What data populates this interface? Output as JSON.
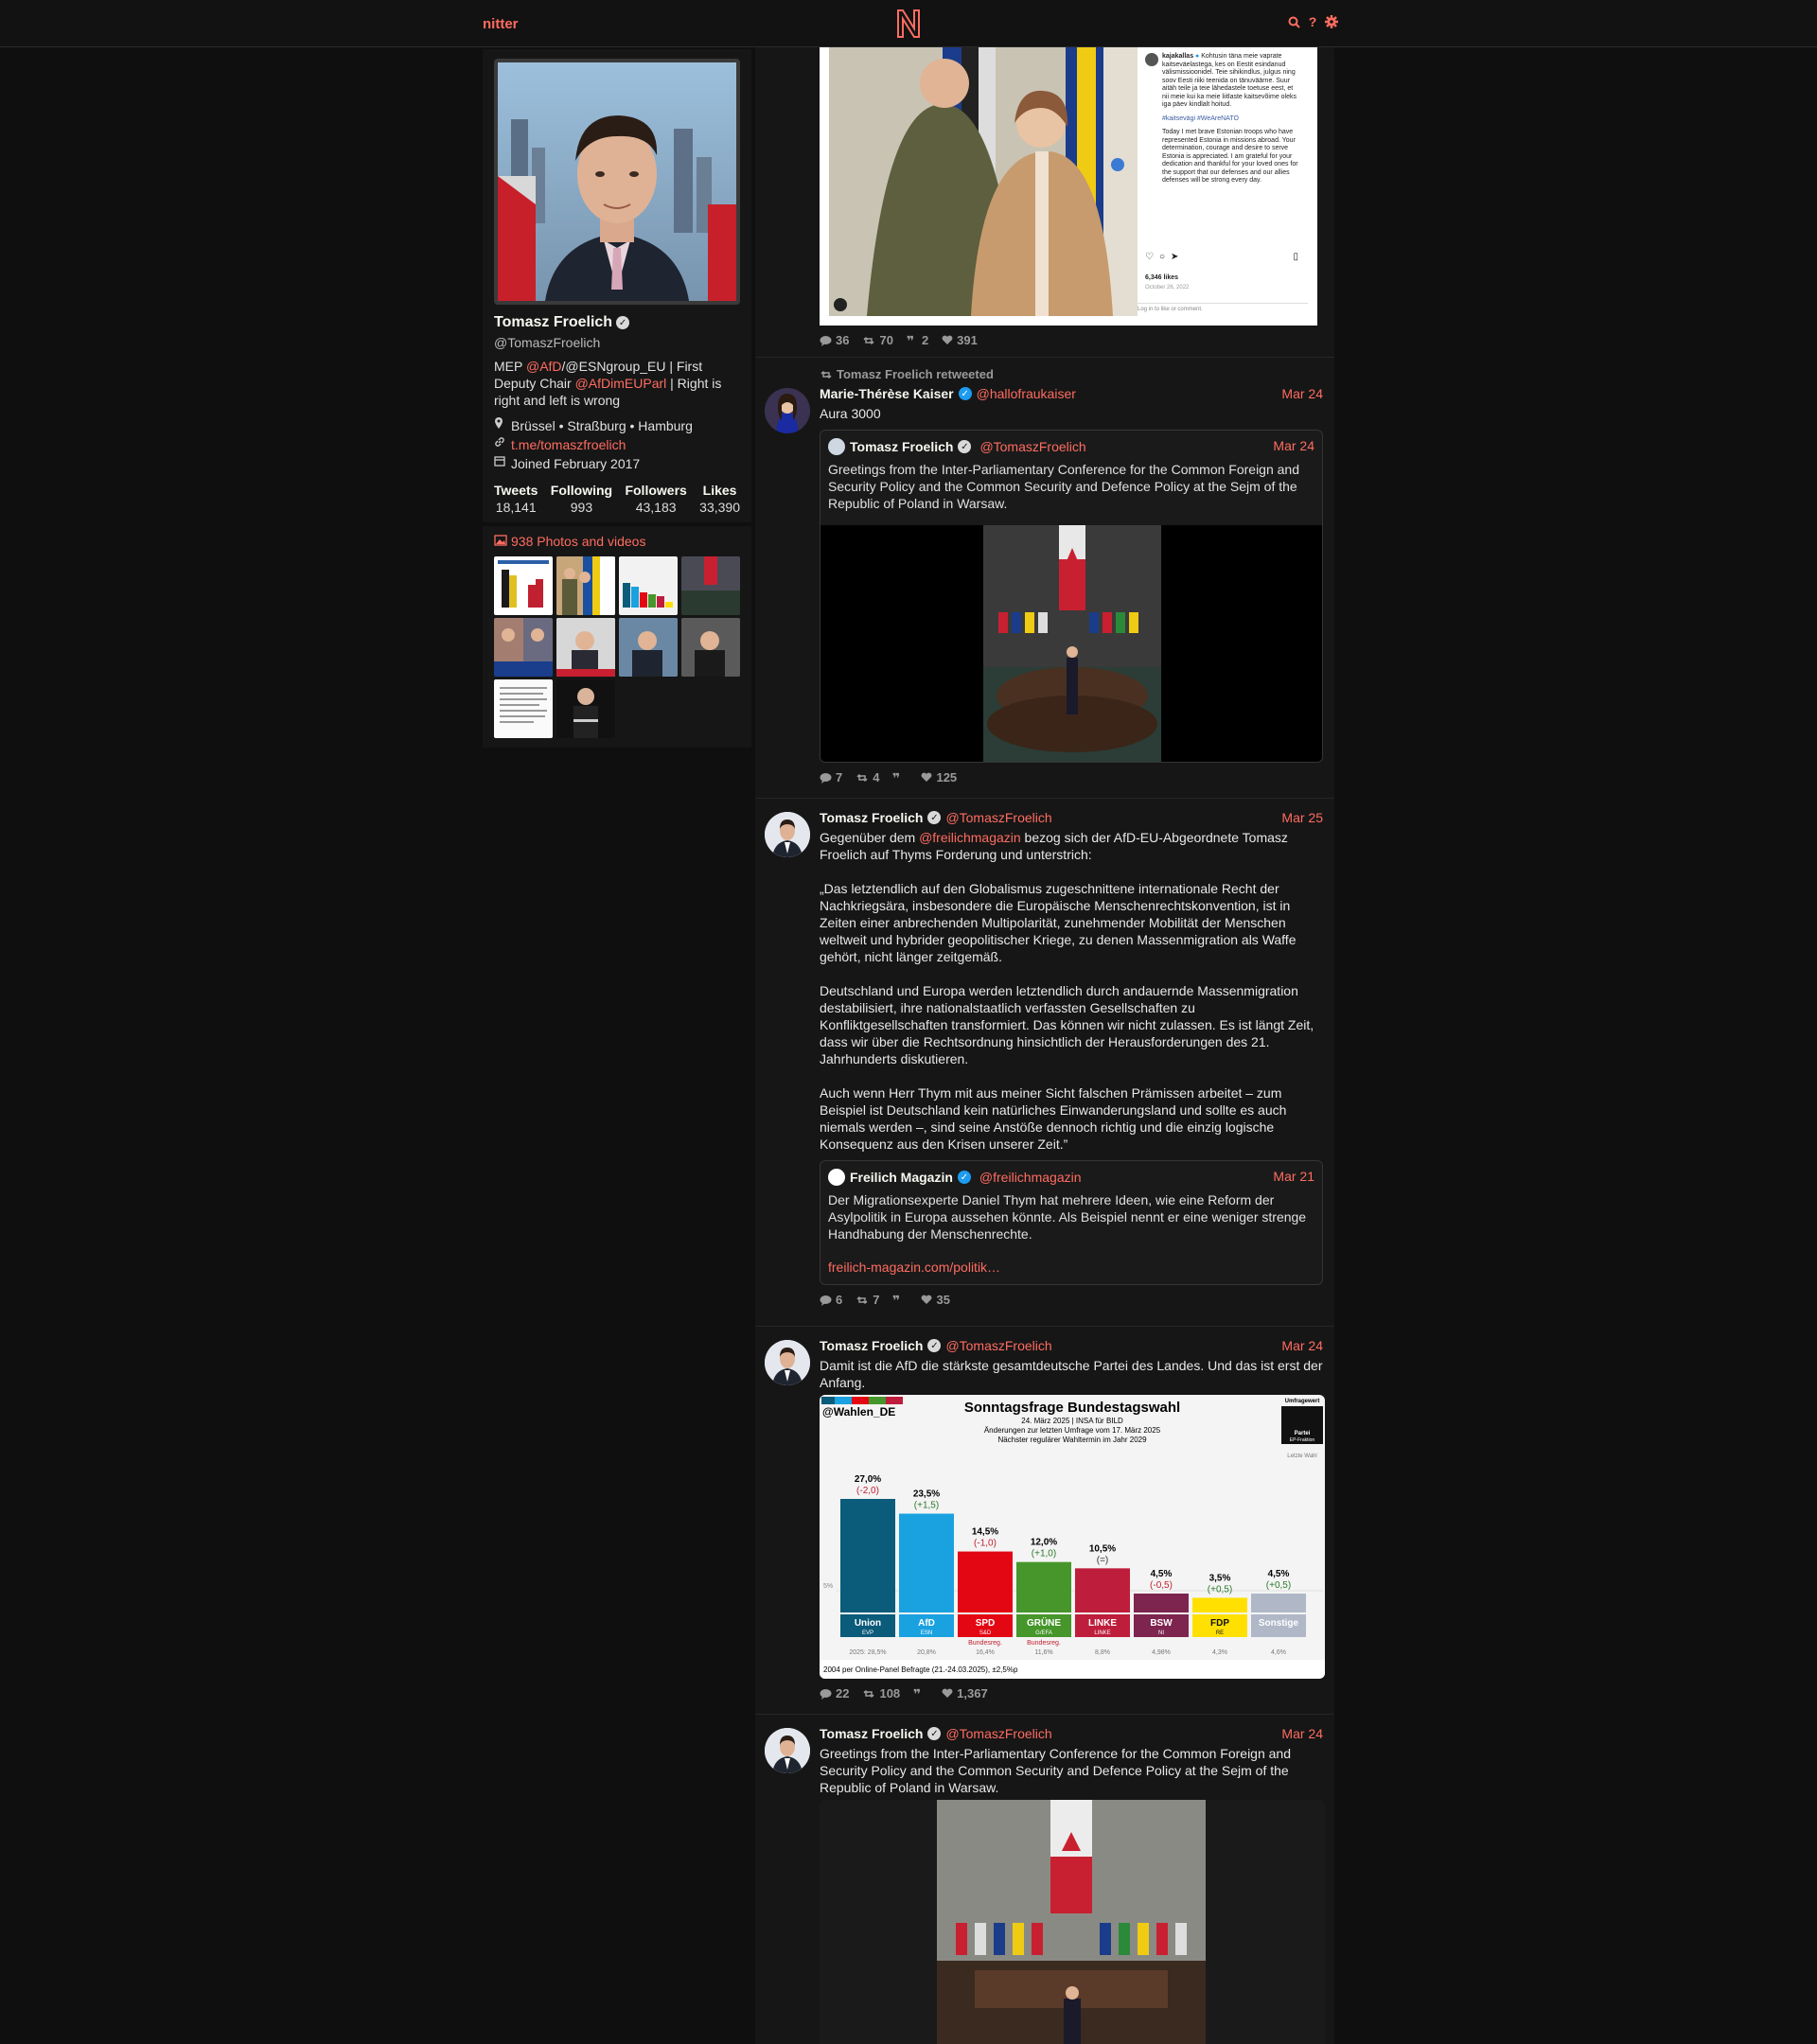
{
  "nav": {
    "brand": "nitter"
  },
  "profile": {
    "name": "Tomasz Froelich",
    "handle": "@TomaszFroelich",
    "bio_1": "MEP ",
    "bio_link_1": "@AfD",
    "bio_2": "/@ESNgroup_EU | First Deputy Chair ",
    "bio_link_2": "@AfDimEUParl",
    "bio_3": " | Right is right and left is wrong",
    "location": "Brüssel • Straßburg • Hamburg",
    "website": "t.me/tomaszfroelich",
    "joined": "Joined February 2017",
    "stats": [
      {
        "label": "Tweets",
        "value": "18,141"
      },
      {
        "label": "Following",
        "value": "993"
      },
      {
        "label": "Followers",
        "value": "43,183"
      },
      {
        "label": "Likes",
        "value": "33,390"
      }
    ]
  },
  "media": {
    "title": "938 Photos and videos"
  },
  "tweets": [
    {
      "stats": {
        "replies": "36",
        "retweets": "70",
        "quotes": "2",
        "likes": "391"
      },
      "insta": {
        "user": "kajakallas",
        "text_et": "Kohtusin täna meie vaprate kaitseväelastega, kes on Eestit esindanud välismissioonidel. Teie sihikindlus, julgus ning soov Eesti riiki teenida on tänuväärne. Suur aitäh teile ja teie lähedastele toetuse eest, et nii meie kui ka meie liitlaste kaitsevõime oleks iga päev kindlalt hoitud.",
        "hashtags": "#kaitsevägi #WeAreNATO",
        "text_en": "Today I met brave Estonian troops who have represented Estonia in missions abroad. Your determination, courage and desire to serve Estonia is appreciated. I am grateful for your dedication and thankful for your loved ones for the support that our defenses and our allies defenses will be strong every day.",
        "likes": "6,346 likes",
        "date": "October 26, 2022",
        "login": "Log in to like or comment."
      }
    },
    {
      "retweet_label": "Tomasz Froelich retweeted",
      "name": "Marie-Thérèse Kaiser",
      "handle": "@hallofraukaiser",
      "date": "Mar 24",
      "text": "Aura 3000",
      "quote": {
        "name": "Tomasz Froelich",
        "handle": "@TomaszFroelich",
        "date": "Mar 24",
        "text": "Greetings from the Inter-Parliamentary Conference for the Common Foreign and Security Policy and the Common Security and Defence Policy at the Sejm of the Republic of Poland in Warsaw."
      },
      "stats": {
        "replies": "7",
        "retweets": "4",
        "quotes": "",
        "likes": "125"
      }
    },
    {
      "name": "Tomasz Froelich",
      "handle": "@TomaszFroelich",
      "date": "Mar 25",
      "text_1": "Gegenüber dem ",
      "text_link": "@freilichmagazin",
      "text_2": " bezog sich der AfD-EU-Abgeordnete Tomasz Froelich auf Thyms Forderung und unterstrich:",
      "para_1": "„Das letztendlich auf den Globalismus zugeschnittene internationale Recht der Nachkriegsära, insbesondere die Europäische Menschenrechtskonvention, ist in Zeiten einer anbrechenden Multipolarität, zunehmender Mobilität der Menschen weltweit und hybrider geopolitischer Kriege, zu denen Massenmigration als Waffe gehört, nicht länger zeitgemäß.",
      "para_2": "Deutschland und Europa werden letztendlich durch andauernde Massenmigration destabilisiert, ihre nationalstaatlich verfassten Gesellschaften zu Konfliktgesellschaften transformiert. Das können wir nicht zulassen. Es ist längt Zeit, dass wir über die Rechtsordnung hinsichtlich der Herausforderungen des 21. Jahrhunderts diskutieren.",
      "para_3": "Auch wenn Herr Thym mit aus meiner Sicht falschen Prämissen arbeitet – zum Beispiel ist Deutschland kein natürliches Einwanderungsland und sollte es auch niemals werden –, sind seine Anstöße dennoch richtig und die einzig logische Konsequenz aus den Krisen unserer Zeit.”",
      "quote": {
        "name": "Freilich Magazin",
        "handle": "@freilichmagazin",
        "date": "Mar 21",
        "text": "Der Migrationsexperte Daniel Thym hat mehrere Ideen, wie eine Reform der Asylpolitik in Europa aussehen könnte. Als Beispiel nennt er eine weniger strenge Handhabung der Menschenrechte.",
        "link": "freilich-magazin.com/politik…"
      },
      "stats": {
        "replies": "6",
        "retweets": "7",
        "quotes": "",
        "likes": "35"
      }
    },
    {
      "name": "Tomasz Froelich",
      "handle": "@TomaszFroelich",
      "date": "Mar 24",
      "text": "Damit ist die AfD die stärkste gesamtdeutsche Partei des Landes. Und das ist erst der Anfang.",
      "stats": {
        "replies": "22",
        "retweets": "108",
        "quotes": "",
        "likes": "1,367"
      }
    },
    {
      "name": "Tomasz Froelich",
      "handle": "@TomaszFroelich",
      "date": "Mar 24",
      "text": "Greetings from the Inter-Parliamentary Conference for the Common Foreign and Security Policy and the Common Security and Defence Policy at the Sejm of the Republic of Poland in Warsaw."
    }
  ],
  "poll_chart": {
    "handle": "@Wahlen_DE",
    "title": "Sonntagsfrage Bundestagswahl",
    "line1": "24. März 2025 | INSA für BILD",
    "line2": "Änderungen zur letzten Umfrage vom 17. März 2025",
    "line3": "Nächster regulärer Wahltermin im Jahr 2029",
    "legend_top": "Umfragewert",
    "legend_mid": "Partei",
    "legend_sub": "EP-Fraktion",
    "legend_bottom": "Letzte Wahl",
    "threshold": "5%",
    "footer": "2004 per Online-Panel Befragte (21.-24.03.2025), ±2,5%p",
    "colors": {
      "union": "#0b5b7a",
      "afd": "#1aa1e0",
      "spd": "#e30613",
      "gruene": "#46962b",
      "linke": "#be1e3c",
      "bsw": "#7d254f",
      "fdp": "#ffe000",
      "sonstige": "#b0b8c8"
    }
  },
  "chart_data": {
    "type": "bar",
    "title": "Sonntagsfrage Bundestagswahl",
    "categories": [
      "Union",
      "AfD",
      "SPD",
      "GRÜNE",
      "LINKE",
      "BSW",
      "FDP",
      "Sonstige"
    ],
    "subcategories": [
      "EVP",
      "ESN",
      "S&D",
      "G/EFA",
      "LINKE",
      "NI",
      "RE",
      ""
    ],
    "values": [
      27.0,
      23.5,
      14.5,
      12.0,
      10.5,
      4.5,
      3.5,
      4.5
    ],
    "value_labels": [
      "27,0%",
      "23,5%",
      "14,5%",
      "12,0%",
      "10,5%",
      "4,5%",
      "3,5%",
      "4,5%"
    ],
    "changes": [
      "(-2,0)",
      "(+1,5)",
      "(-1,0)",
      "(+1,0)",
      "(=)",
      "(-0,5)",
      "(+0,5)",
      "(+0,5)"
    ],
    "last_election": [
      "2025: 28,5%",
      "20,8%",
      "16,4%",
      "11,6%",
      "8,8%",
      "4,98%",
      "4,3%",
      "4,6%"
    ],
    "notes": [
      "",
      "",
      "Bundesreg.",
      "Bundesreg.",
      "",
      "",
      "",
      ""
    ],
    "ylim": [
      0,
      30
    ]
  }
}
